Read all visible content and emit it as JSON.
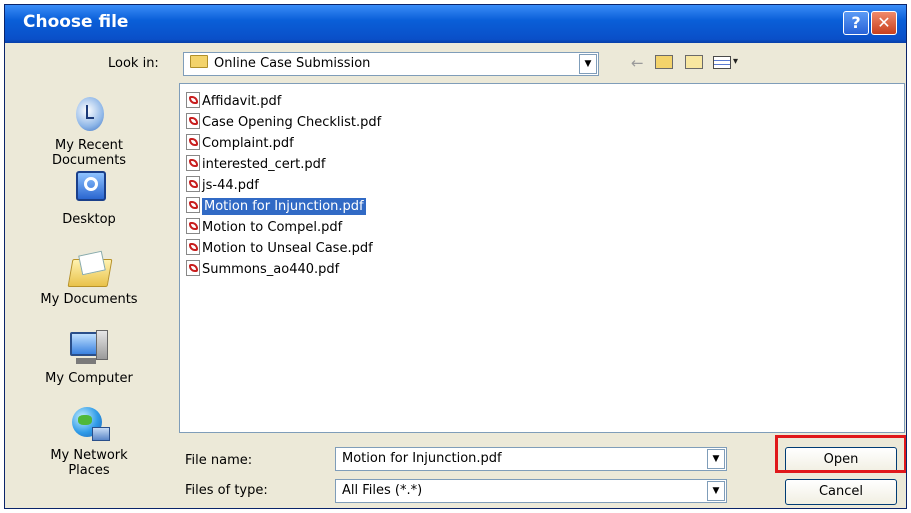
{
  "window": {
    "title": "Choose file"
  },
  "toolbar": {
    "look_in_label": "Look in:",
    "current_folder": "Online Case Submission"
  },
  "sidebar": {
    "items": [
      {
        "label_line1": "My Recent",
        "label_line2": "Documents"
      },
      {
        "label_line1": "Desktop",
        "label_line2": ""
      },
      {
        "label_line1": "My Documents",
        "label_line2": ""
      },
      {
        "label_line1": "My Computer",
        "label_line2": ""
      },
      {
        "label_line1": "My Network",
        "label_line2": "Places"
      }
    ]
  },
  "files": [
    "Affidavit.pdf",
    "Case Opening Checklist.pdf",
    "Complaint.pdf",
    "interested_cert.pdf",
    "js-44.pdf",
    "Motion for Injunction.pdf",
    "Motion to Compel.pdf",
    "Motion to Unseal Case.pdf",
    "Summons_ao440.pdf"
  ],
  "selected_file": "Motion for Injunction.pdf",
  "footer": {
    "file_name_label": "File name:",
    "file_name_value": "Motion for Injunction.pdf",
    "file_type_label": "Files of type:",
    "file_type_value": "All Files (*.*)",
    "open_label": "Open",
    "cancel_label": "Cancel"
  },
  "colors": {
    "titlebar": "#0a5fd8",
    "selection": "#316ac5",
    "highlight_box": "#e0181b"
  }
}
